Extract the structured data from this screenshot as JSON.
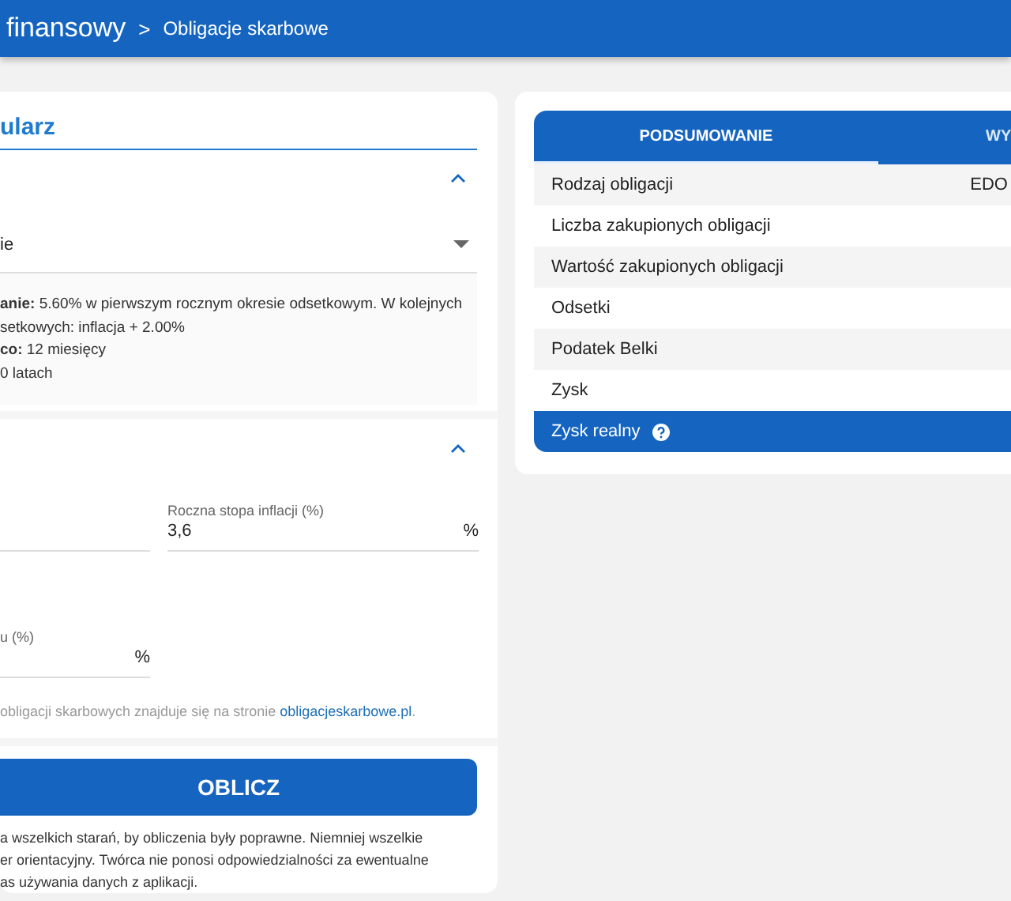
{
  "breadcrumb": {
    "parent": "finansowy",
    "separator": ">",
    "current": "Obligacje skarbowe"
  },
  "form": {
    "title": "ularz",
    "sections": [
      {
        "expanded": true,
        "select": {
          "value": "ie"
        },
        "info": [
          "**anie:** 5.60% w pierwszym rocznym okresie odsetkowym. W kolejnych",
          "setkowych: inflacja + 2.00%",
          "**co:** 12 miesięcy",
          "0 latach"
        ]
      },
      {
        "expanded": true,
        "fields": [
          {
            "kind": "number"
          },
          {
            "kind": "number",
            "label": "Roczna stopa inflacji (%)",
            "value": "3,6",
            "suffix": "%"
          },
          {
            "kind": "number",
            "label": "u (%)",
            "suffix": "%"
          }
        ],
        "note": {
          "text": "obligacji skarbowych znajduje się na stronie ",
          "link": "obligacjeskarbowe.pl",
          "end": "."
        }
      }
    ],
    "button": "OBLICZ",
    "disclaimer": [
      "a wszelkich starań, by obliczenia były poprawne. Niemniej wszelkie",
      "er orientacyjny. Twórca nie ponosi odpowiedzialności za ewentualne",
      "as używania danych z aplikacji."
    ]
  },
  "results": {
    "tabs": [
      {
        "label": "PODSUMOWANIE",
        "selected": true
      },
      {
        "label": "WY",
        "selected": false
      }
    ],
    "rows": [
      {
        "label": "Rodzaj obligacji",
        "value": "EDO",
        "highlighted": false,
        "help": false
      },
      {
        "label": "Liczba zakupionych obligacji",
        "highlighted": false,
        "help": false
      },
      {
        "label": "Wartość zakupionych obligacji",
        "highlighted": false,
        "help": false
      },
      {
        "label": "Odsetki",
        "highlighted": false,
        "help": false
      },
      {
        "label": "Podatek Belki",
        "highlighted": false,
        "help": false
      },
      {
        "label": "Zysk",
        "highlighted": false,
        "help": false
      },
      {
        "label": "Zysk realny",
        "highlighted": true,
        "help": true
      }
    ]
  }
}
